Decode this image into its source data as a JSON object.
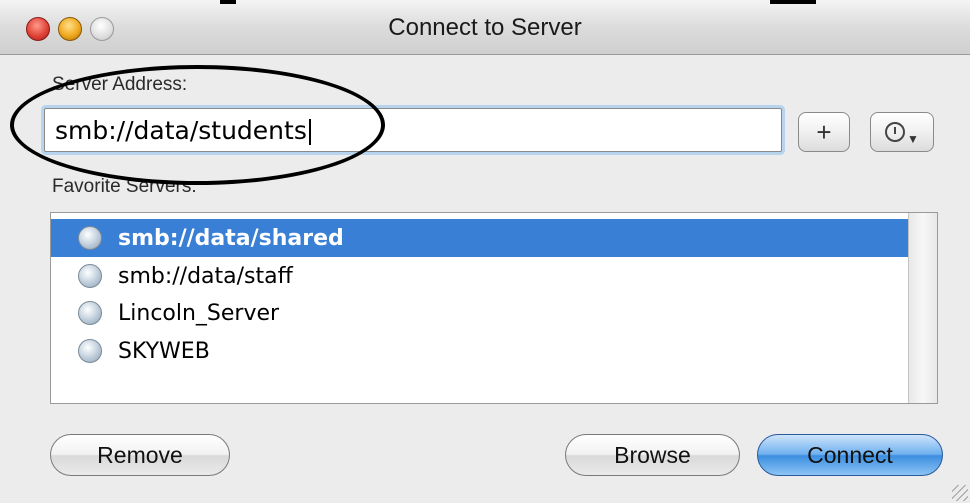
{
  "window": {
    "title": "Connect to Server"
  },
  "server_address": {
    "label": "Server Address:",
    "value": "smb://data/students"
  },
  "toolbar": {
    "add_label": "+"
  },
  "favorites": {
    "label": "Favorite Servers:",
    "items": [
      {
        "label": "smb://data/shared",
        "selected": true
      },
      {
        "label": "smb://data/staff",
        "selected": false
      },
      {
        "label": "Lincoln_Server",
        "selected": false
      },
      {
        "label": "SKYWEB",
        "selected": false
      }
    ]
  },
  "buttons": {
    "remove": "Remove",
    "browse": "Browse",
    "connect": "Connect"
  },
  "colors": {
    "selection": "#3a7fd6",
    "window_bg": "#ececec",
    "default_button": "#3c8ee0"
  },
  "icons": {
    "close": "close-icon",
    "minimize": "minimize-icon",
    "zoom": "zoom-icon",
    "recent": "clock-icon",
    "server": "globe-server-icon"
  }
}
